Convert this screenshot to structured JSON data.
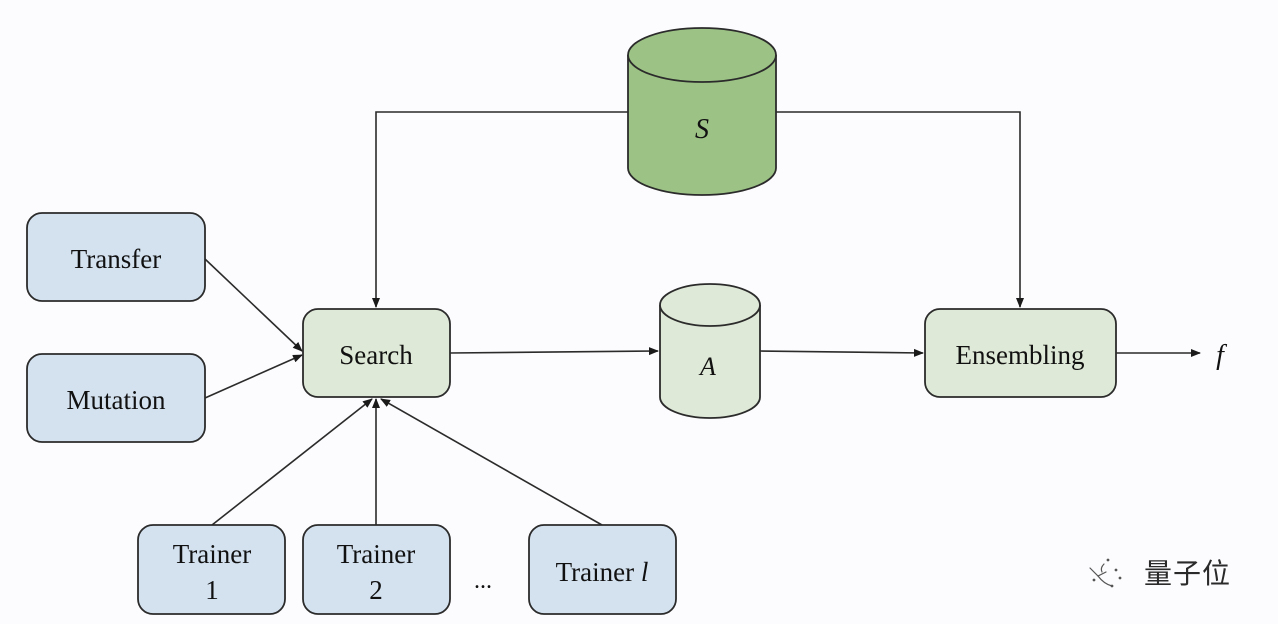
{
  "diagram": {
    "storage": {
      "s_label": "S",
      "a_label": "A"
    },
    "nodes": {
      "transfer": "Transfer",
      "mutation": "Mutation",
      "search": "Search",
      "ensembling": "Ensembling",
      "trainer_1": [
        "Trainer",
        "1"
      ],
      "trainer_2": [
        "Trainer",
        "2"
      ],
      "trainer_l": {
        "prefix": "Trainer ",
        "var": "l"
      },
      "ellipsis": "..."
    },
    "output_label": "f",
    "colors": {
      "blue_box": "#d4e2f0",
      "light_green_box": "#dfe9d7",
      "dark_green_cylinder": "#9cc285",
      "light_green_cylinder": "#dfe9d7",
      "stroke": "#2b2b2b"
    }
  },
  "watermark": {
    "text": "量子位"
  }
}
